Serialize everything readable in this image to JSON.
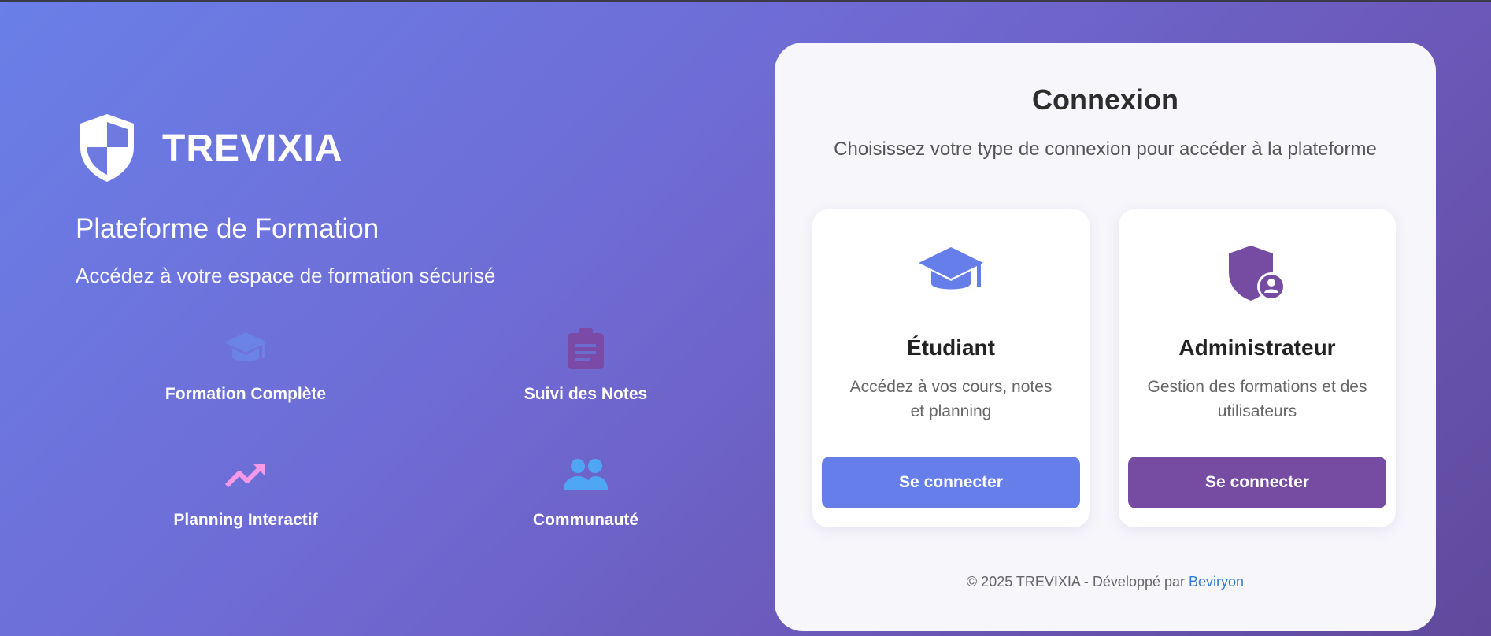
{
  "brand": {
    "name": "TREVIXIA",
    "icon": "shield-icon"
  },
  "hero": {
    "subtitle": "Plateforme de Formation",
    "tagline": "Accédez à votre espace de formation sécurisé"
  },
  "features": [
    {
      "label": "Formation Complète",
      "icon": "graduation-cap-icon",
      "color": "#6b83e6"
    },
    {
      "label": "Suivi des Notes",
      "icon": "clipboard-icon",
      "color": "#7a4aa6"
    },
    {
      "label": "Planning Interactif",
      "icon": "trending-up-icon",
      "color": "#f59ae8"
    },
    {
      "label": "Communauté",
      "icon": "group-icon",
      "color": "#4ea6f4"
    }
  ],
  "login": {
    "title": "Connexion",
    "subtitle": "Choisissez votre type de connexion pour accéder à la plateforme",
    "options": [
      {
        "title": "Étudiant",
        "description": "Accédez à vos cours, notes et planning",
        "button": "Se connecter",
        "icon": "graduation-cap-icon",
        "color": "#667eea"
      },
      {
        "title": "Administrateur",
        "description": "Gestion des formations et des utilisateurs",
        "button": "Se connecter",
        "icon": "admin-shield-icon",
        "color": "#764ba2"
      }
    ]
  },
  "footer": {
    "text": "© 2025 TREVIXIA - Développé par",
    "link": "Beviryon"
  }
}
